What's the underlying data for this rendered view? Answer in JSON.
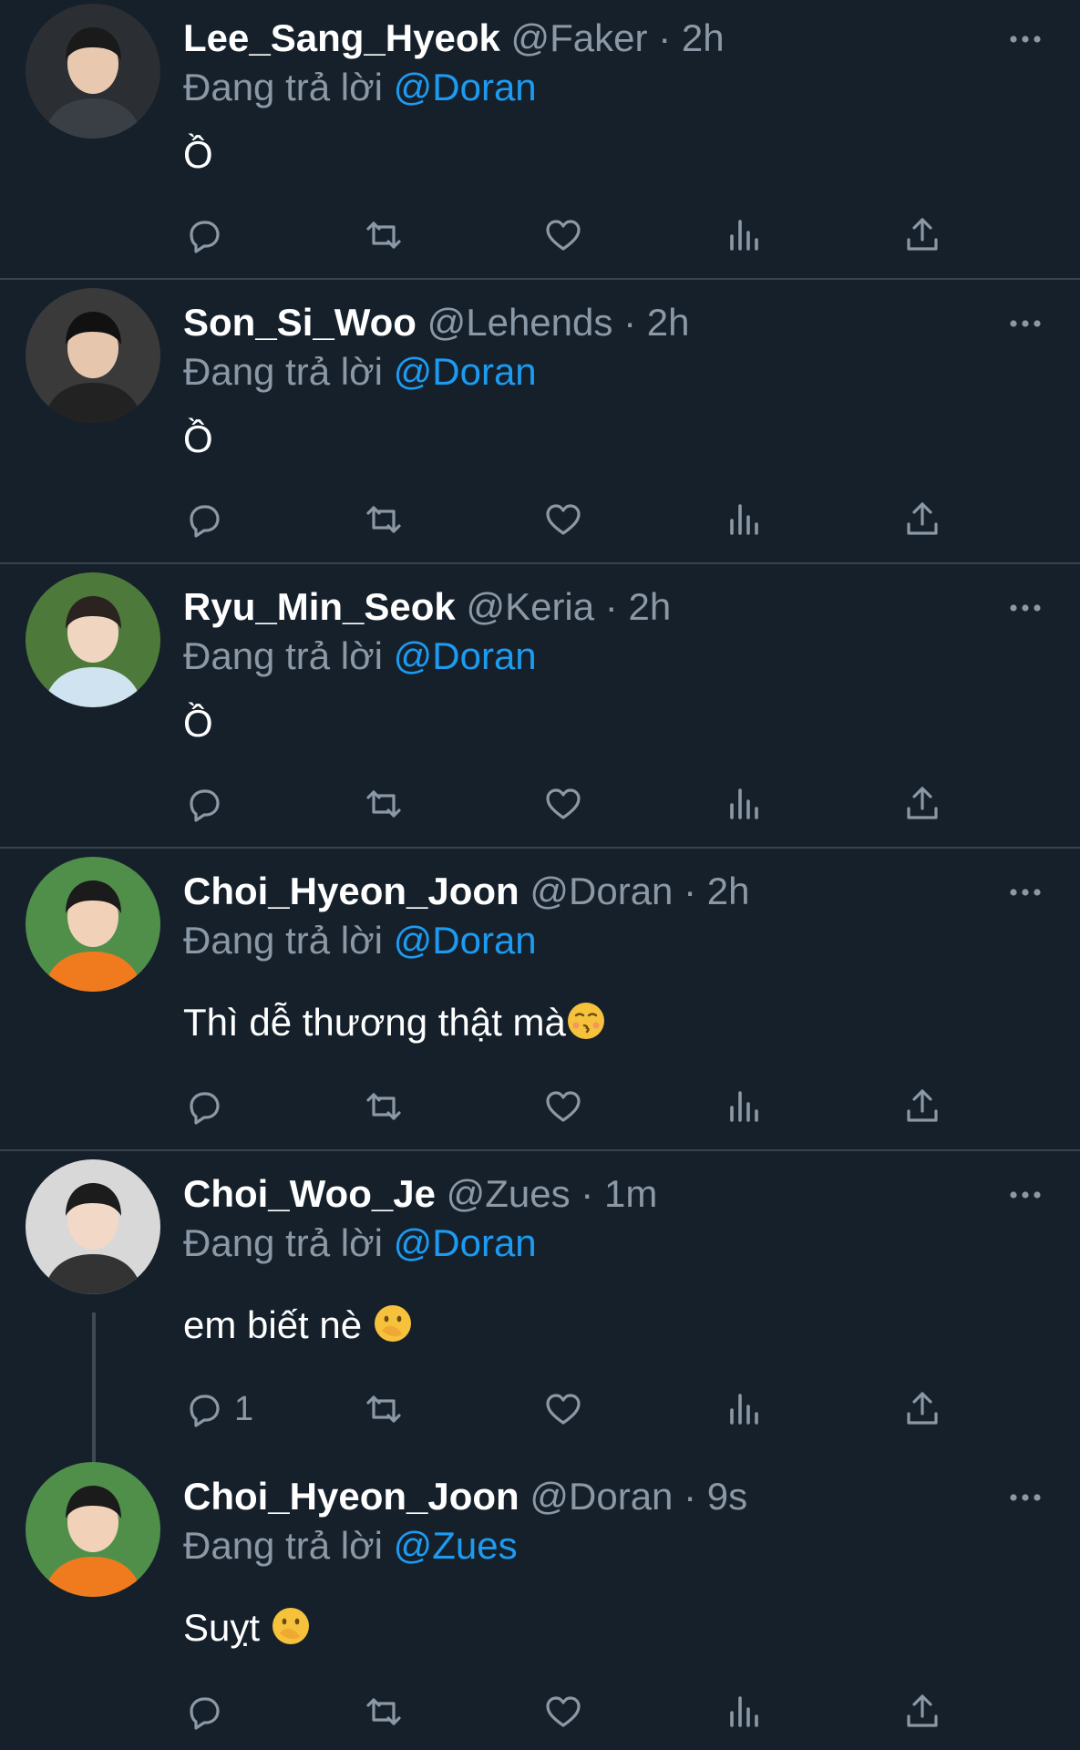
{
  "reply_prefix": "Đang trả lời",
  "colors": {
    "background": "#15202b",
    "divider": "#38444d",
    "secondary_text": "#8b98a5",
    "mention": "#1d9bf0"
  },
  "icons": [
    "reply-icon",
    "retweet-icon",
    "like-icon",
    "analytics-icon",
    "share-icon",
    "more-icon"
  ],
  "tweets": [
    {
      "name": "Lee_Sang_Hyeok",
      "handle": "@Faker",
      "sep": "·",
      "time": "2h",
      "replying_to": "@Doran",
      "text": "Ồ",
      "reply_count": ""
    },
    {
      "name": "Son_Si_Woo",
      "handle": "@Lehends",
      "sep": "·",
      "time": "2h",
      "replying_to": "@Doran",
      "text": "Ồ",
      "reply_count": ""
    },
    {
      "name": "Ryu_Min_Seok",
      "handle": "@Keria",
      "sep": "·",
      "time": "2h",
      "replying_to": "@Doran",
      "text": "Ồ",
      "reply_count": ""
    },
    {
      "name": "Choi_Hyeon_Joon",
      "handle": "@Doran",
      "sep": "·",
      "time": "2h",
      "replying_to": "@Doran",
      "text": "Thì dễ thương thật mà",
      "reply_count": ""
    },
    {
      "name": "Choi_Woo_Je",
      "handle": "@Zues",
      "sep": "·",
      "time": "1m",
      "replying_to": "@Doran",
      "text": "em biết nè ",
      "reply_count": "1"
    },
    {
      "name": "Choi_Hyeon_Joon",
      "handle": "@Doran",
      "sep": "·",
      "time": "9s",
      "replying_to": "@Zues",
      "text": "Suỵt ",
      "reply_count": ""
    }
  ]
}
